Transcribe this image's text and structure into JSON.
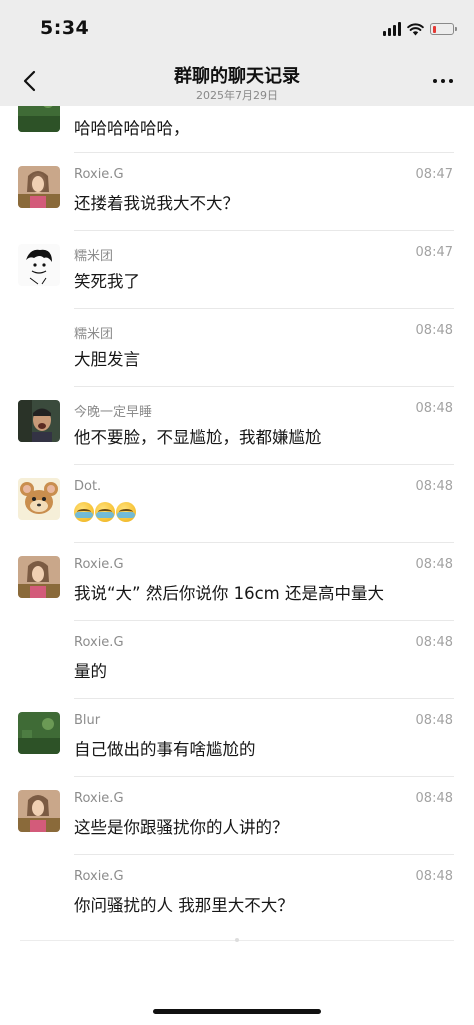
{
  "status_bar": {
    "time": "5:34",
    "icons": [
      "signal-icon",
      "wifi-icon",
      "battery-low-icon"
    ],
    "battery_color": "#e53935"
  },
  "nav": {
    "back_icon": "chevron-left-icon",
    "title": "群聊的聊天记录",
    "subtitle": "2025年7月29日",
    "more_icon": "more-dots-icon"
  },
  "messages": [
    {
      "sender": "",
      "time": "",
      "text": "哈哈哈哈哈哈，",
      "avatar": "green-landscape"
    },
    {
      "sender": "Roxie.G",
      "time": "08:47",
      "text": "还搂着我说我大不大？",
      "avatar": "woman-photo"
    },
    {
      "sender": "糯米团",
      "time": "08:47",
      "text": "笑死我了",
      "avatar": "sketch-drawing"
    },
    {
      "sender": "糯米团",
      "time": "08:48",
      "text": "大胆发言",
      "avatar": ""
    },
    {
      "sender": "今晚一定早睡",
      "time": "08:48",
      "text": "他不要脸，不显尴尬，我都嫌尴尬",
      "avatar": "man-photo"
    },
    {
      "sender": "Dot.",
      "time": "08:48",
      "text": "",
      "emoji": [
        "crying-laughing-emoji",
        "crying-laughing-emoji",
        "crying-laughing-emoji"
      ],
      "avatar": "cartoon-mouse"
    },
    {
      "sender": "Roxie.G",
      "time": "08:48",
      "text": "我说“大” 然后你说你 16cm 还是高中量大",
      "avatar": "woman-photo"
    },
    {
      "sender": "Roxie.G",
      "time": "08:48",
      "text": "量的",
      "avatar": ""
    },
    {
      "sender": "Blur",
      "time": "08:48",
      "text": "自己做出的事有啥尴尬的",
      "avatar": "green-landscape"
    },
    {
      "sender": "Roxie.G",
      "time": "08:48",
      "text": "这些是你跟骚扰你的人讲的？",
      "avatar": "woman-photo"
    },
    {
      "sender": "Roxie.G",
      "time": "08:48",
      "text": "你问骚扰的人 我那里大不大？",
      "avatar": ""
    }
  ]
}
